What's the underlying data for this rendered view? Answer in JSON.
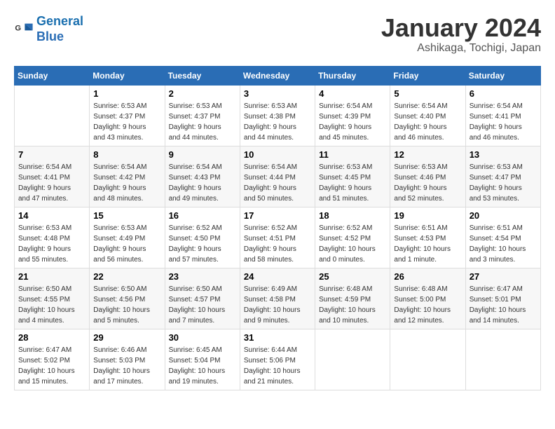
{
  "logo": {
    "text_general": "General",
    "text_blue": "Blue"
  },
  "title": "January 2024",
  "location": "Ashikaga, Tochigi, Japan",
  "weekdays": [
    "Sunday",
    "Monday",
    "Tuesday",
    "Wednesday",
    "Thursday",
    "Friday",
    "Saturday"
  ],
  "weeks": [
    [
      {
        "day": "",
        "info": ""
      },
      {
        "day": "1",
        "info": "Sunrise: 6:53 AM\nSunset: 4:37 PM\nDaylight: 9 hours\nand 43 minutes."
      },
      {
        "day": "2",
        "info": "Sunrise: 6:53 AM\nSunset: 4:37 PM\nDaylight: 9 hours\nand 44 minutes."
      },
      {
        "day": "3",
        "info": "Sunrise: 6:53 AM\nSunset: 4:38 PM\nDaylight: 9 hours\nand 44 minutes."
      },
      {
        "day": "4",
        "info": "Sunrise: 6:54 AM\nSunset: 4:39 PM\nDaylight: 9 hours\nand 45 minutes."
      },
      {
        "day": "5",
        "info": "Sunrise: 6:54 AM\nSunset: 4:40 PM\nDaylight: 9 hours\nand 46 minutes."
      },
      {
        "day": "6",
        "info": "Sunrise: 6:54 AM\nSunset: 4:41 PM\nDaylight: 9 hours\nand 46 minutes."
      }
    ],
    [
      {
        "day": "7",
        "info": "Sunrise: 6:54 AM\nSunset: 4:41 PM\nDaylight: 9 hours\nand 47 minutes."
      },
      {
        "day": "8",
        "info": "Sunrise: 6:54 AM\nSunset: 4:42 PM\nDaylight: 9 hours\nand 48 minutes."
      },
      {
        "day": "9",
        "info": "Sunrise: 6:54 AM\nSunset: 4:43 PM\nDaylight: 9 hours\nand 49 minutes."
      },
      {
        "day": "10",
        "info": "Sunrise: 6:54 AM\nSunset: 4:44 PM\nDaylight: 9 hours\nand 50 minutes."
      },
      {
        "day": "11",
        "info": "Sunrise: 6:53 AM\nSunset: 4:45 PM\nDaylight: 9 hours\nand 51 minutes."
      },
      {
        "day": "12",
        "info": "Sunrise: 6:53 AM\nSunset: 4:46 PM\nDaylight: 9 hours\nand 52 minutes."
      },
      {
        "day": "13",
        "info": "Sunrise: 6:53 AM\nSunset: 4:47 PM\nDaylight: 9 hours\nand 53 minutes."
      }
    ],
    [
      {
        "day": "14",
        "info": "Sunrise: 6:53 AM\nSunset: 4:48 PM\nDaylight: 9 hours\nand 55 minutes."
      },
      {
        "day": "15",
        "info": "Sunrise: 6:53 AM\nSunset: 4:49 PM\nDaylight: 9 hours\nand 56 minutes."
      },
      {
        "day": "16",
        "info": "Sunrise: 6:52 AM\nSunset: 4:50 PM\nDaylight: 9 hours\nand 57 minutes."
      },
      {
        "day": "17",
        "info": "Sunrise: 6:52 AM\nSunset: 4:51 PM\nDaylight: 9 hours\nand 58 minutes."
      },
      {
        "day": "18",
        "info": "Sunrise: 6:52 AM\nSunset: 4:52 PM\nDaylight: 10 hours\nand 0 minutes."
      },
      {
        "day": "19",
        "info": "Sunrise: 6:51 AM\nSunset: 4:53 PM\nDaylight: 10 hours\nand 1 minute."
      },
      {
        "day": "20",
        "info": "Sunrise: 6:51 AM\nSunset: 4:54 PM\nDaylight: 10 hours\nand 3 minutes."
      }
    ],
    [
      {
        "day": "21",
        "info": "Sunrise: 6:50 AM\nSunset: 4:55 PM\nDaylight: 10 hours\nand 4 minutes."
      },
      {
        "day": "22",
        "info": "Sunrise: 6:50 AM\nSunset: 4:56 PM\nDaylight: 10 hours\nand 5 minutes."
      },
      {
        "day": "23",
        "info": "Sunrise: 6:50 AM\nSunset: 4:57 PM\nDaylight: 10 hours\nand 7 minutes."
      },
      {
        "day": "24",
        "info": "Sunrise: 6:49 AM\nSunset: 4:58 PM\nDaylight: 10 hours\nand 9 minutes."
      },
      {
        "day": "25",
        "info": "Sunrise: 6:48 AM\nSunset: 4:59 PM\nDaylight: 10 hours\nand 10 minutes."
      },
      {
        "day": "26",
        "info": "Sunrise: 6:48 AM\nSunset: 5:00 PM\nDaylight: 10 hours\nand 12 minutes."
      },
      {
        "day": "27",
        "info": "Sunrise: 6:47 AM\nSunset: 5:01 PM\nDaylight: 10 hours\nand 14 minutes."
      }
    ],
    [
      {
        "day": "28",
        "info": "Sunrise: 6:47 AM\nSunset: 5:02 PM\nDaylight: 10 hours\nand 15 minutes."
      },
      {
        "day": "29",
        "info": "Sunrise: 6:46 AM\nSunset: 5:03 PM\nDaylight: 10 hours\nand 17 minutes."
      },
      {
        "day": "30",
        "info": "Sunrise: 6:45 AM\nSunset: 5:04 PM\nDaylight: 10 hours\nand 19 minutes."
      },
      {
        "day": "31",
        "info": "Sunrise: 6:44 AM\nSunset: 5:06 PM\nDaylight: 10 hours\nand 21 minutes."
      },
      {
        "day": "",
        "info": ""
      },
      {
        "day": "",
        "info": ""
      },
      {
        "day": "",
        "info": ""
      }
    ]
  ]
}
